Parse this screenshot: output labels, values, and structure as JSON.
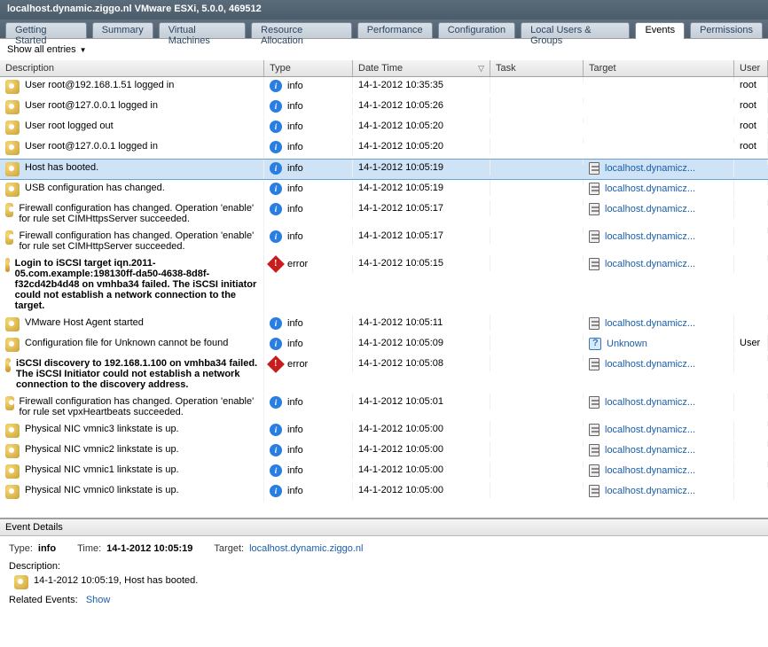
{
  "title": "localhost.dynamic.ziggo.nl VMware ESXi, 5.0.0, 469512",
  "tabs": [
    "Getting Started",
    "Summary",
    "Virtual Machines",
    "Resource Allocation",
    "Performance",
    "Configuration",
    "Local Users & Groups",
    "Events",
    "Permissions"
  ],
  "active_tab": 7,
  "toolbar": {
    "show_all": "Show all entries"
  },
  "columns": {
    "description": "Description",
    "type": "Type",
    "datetime": "Date Time",
    "task": "Task",
    "target": "Target",
    "user": "User"
  },
  "link_trim": "localhost.dynamicz...",
  "unknown_label": "Unknown",
  "events": [
    {
      "desc": "User root@192.168.1.51 logged in",
      "type": "info",
      "dt": "14-1-2012 10:35:35",
      "target": "",
      "user": "root",
      "bold": false,
      "sel": false,
      "ei": "norm",
      "ti": "info"
    },
    {
      "desc": "User root@127.0.0.1 logged in",
      "type": "info",
      "dt": "14-1-2012 10:05:26",
      "target": "",
      "user": "root",
      "bold": false,
      "sel": false,
      "ei": "norm",
      "ti": "info"
    },
    {
      "desc": "User root logged out",
      "type": "info",
      "dt": "14-1-2012 10:05:20",
      "target": "",
      "user": "root",
      "bold": false,
      "sel": false,
      "ei": "norm",
      "ti": "info"
    },
    {
      "desc": "User root@127.0.0.1 logged in",
      "type": "info",
      "dt": "14-1-2012 10:05:20",
      "target": "",
      "user": "root",
      "bold": false,
      "sel": false,
      "ei": "norm",
      "ti": "info"
    },
    {
      "desc": "Host has booted.",
      "type": "info",
      "dt": "14-1-2012 10:05:19",
      "target": "host",
      "user": "",
      "bold": false,
      "sel": true,
      "ei": "norm",
      "ti": "info"
    },
    {
      "desc": "USB configuration has changed.",
      "type": "info",
      "dt": "14-1-2012 10:05:19",
      "target": "host",
      "user": "",
      "bold": false,
      "sel": false,
      "ei": "norm",
      "ti": "info"
    },
    {
      "desc": "Firewall configuration has changed. Operation 'enable' for rule set CIMHttpsServer succeeded.",
      "type": "info",
      "dt": "14-1-2012 10:05:17",
      "target": "host",
      "user": "",
      "bold": false,
      "sel": false,
      "ei": "norm",
      "ti": "info"
    },
    {
      "desc": "Firewall configuration has changed. Operation 'enable' for rule set CIMHttpServer succeeded.",
      "type": "info",
      "dt": "14-1-2012 10:05:17",
      "target": "host",
      "user": "",
      "bold": false,
      "sel": false,
      "ei": "norm",
      "ti": "info"
    },
    {
      "desc": "Login to iSCSI target iqn.2011-05.com.example:198130ff-da50-4638-8d8f-f32cd42b4d48 on vmhba34 failed. The iSCSI initiator could not establish a network connection to the target.",
      "type": "error",
      "dt": "14-1-2012 10:05:15",
      "target": "host",
      "user": "",
      "bold": true,
      "sel": false,
      "ei": "alert",
      "ti": "error"
    },
    {
      "desc": "VMware Host Agent started",
      "type": "info",
      "dt": "14-1-2012 10:05:11",
      "target": "host",
      "user": "",
      "bold": false,
      "sel": false,
      "ei": "norm",
      "ti": "info"
    },
    {
      "desc": "Configuration file for Unknown cannot be found",
      "type": "info",
      "dt": "14-1-2012 10:05:09",
      "target": "unknown",
      "user": "User",
      "bold": false,
      "sel": false,
      "ei": "norm",
      "ti": "info"
    },
    {
      "desc": "iSCSI discovery to 192.168.1.100 on vmhba34 failed. The iSCSI Initiator could not establish a network connection to the discovery address.",
      "type": "error",
      "dt": "14-1-2012 10:05:08",
      "target": "host",
      "user": "",
      "bold": true,
      "sel": false,
      "ei": "alert",
      "ti": "error"
    },
    {
      "desc": "Firewall configuration has changed. Operation 'enable' for rule set vpxHeartbeats succeeded.",
      "type": "info",
      "dt": "14-1-2012 10:05:01",
      "target": "host",
      "user": "",
      "bold": false,
      "sel": false,
      "ei": "norm",
      "ti": "info"
    },
    {
      "desc": "Physical NIC vmnic3 linkstate is up.",
      "type": "info",
      "dt": "14-1-2012 10:05:00",
      "target": "host",
      "user": "",
      "bold": false,
      "sel": false,
      "ei": "norm",
      "ti": "info"
    },
    {
      "desc": "Physical NIC vmnic2 linkstate is up.",
      "type": "info",
      "dt": "14-1-2012 10:05:00",
      "target": "host",
      "user": "",
      "bold": false,
      "sel": false,
      "ei": "norm",
      "ti": "info"
    },
    {
      "desc": "Physical NIC vmnic1 linkstate is up.",
      "type": "info",
      "dt": "14-1-2012 10:05:00",
      "target": "host",
      "user": "",
      "bold": false,
      "sel": false,
      "ei": "norm",
      "ti": "info"
    },
    {
      "desc": "Physical NIC vmnic0 linkstate is up.",
      "type": "info",
      "dt": "14-1-2012 10:05:00",
      "target": "host",
      "user": "",
      "bold": false,
      "sel": false,
      "ei": "norm",
      "ti": "info"
    }
  ],
  "details": {
    "header": "Event Details",
    "type_k": "Type:",
    "type_v": "info",
    "time_k": "Time:",
    "time_v": "14-1-2012 10:05:19",
    "target_k": "Target:",
    "target_v": "localhost.dynamic.ziggo.nl",
    "desc_k": "Description:",
    "desc_v": "14-1-2012 10:05:19,   Host has booted.",
    "related_k": "Related Events:",
    "show": "Show"
  }
}
